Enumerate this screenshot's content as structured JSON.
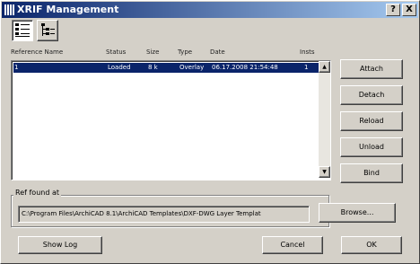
{
  "window": {
    "title": "XRIF Management",
    "help_label": "?",
    "close_label": "X"
  },
  "columns": [
    "Reference Name",
    "Status",
    "Size",
    "Type",
    "Date",
    "Insts"
  ],
  "rows": [
    {
      "name": "1",
      "status": "Loaded",
      "size": "8 k",
      "type": "Overlay",
      "date": "06.17.2008 21:54:48",
      "insts": "1"
    }
  ],
  "side_buttons": {
    "attach": "Attach",
    "detach": "Detach",
    "reload": "Reload",
    "unload": "Unload",
    "bind": "Bind"
  },
  "found_at": {
    "label": "Ref found at",
    "path": "C:\\Program Files\\ArchiCAD 8.1\\ArchiCAD Templates\\DXF-DWG Layer Templat",
    "browse_label": "Browse..."
  },
  "bottom_buttons": {
    "show_log": "Show Log",
    "cancel": "Cancel",
    "ok": "OK"
  },
  "icons": {
    "title": "xref-app-icon",
    "view_list": "list-view-icon",
    "view_tree": "tree-view-icon"
  }
}
